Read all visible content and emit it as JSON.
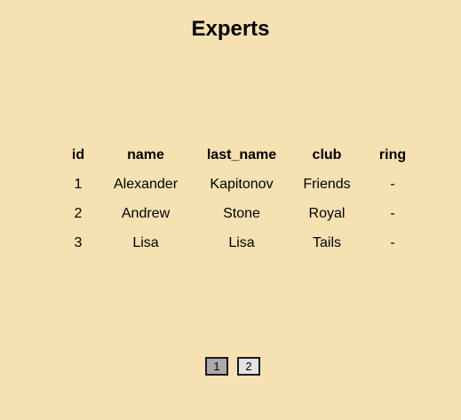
{
  "page": {
    "title": "Experts"
  },
  "table": {
    "headers": {
      "id": "id",
      "name": "name",
      "last_name": "last_name",
      "club": "club",
      "ring": "ring"
    },
    "rows": [
      {
        "id": "1",
        "name": "Alexander",
        "last_name": "Kapitonov",
        "club": "Friends",
        "ring": "-"
      },
      {
        "id": "2",
        "name": "Andrew",
        "last_name": "Stone",
        "club": "Royal",
        "ring": "-"
      },
      {
        "id": "3",
        "name": "Lisa",
        "last_name": "Lisa",
        "club": "Tails",
        "ring": "-"
      }
    ]
  },
  "pagination": {
    "pages": [
      "1",
      "2"
    ],
    "current": "1"
  },
  "colors": {
    "background": "#f5e1b2",
    "active_page": "#a9a9a9",
    "inactive_page": "#e3e3e3"
  }
}
